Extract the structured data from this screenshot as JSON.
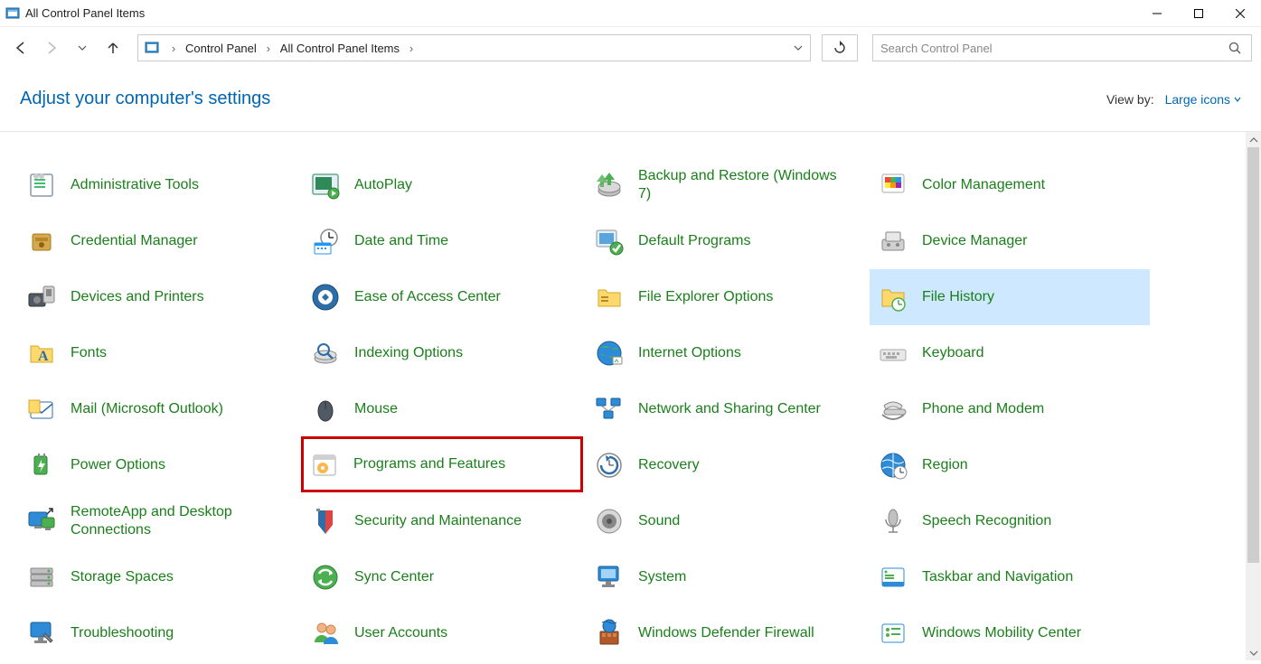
{
  "window": {
    "title": "All Control Panel Items"
  },
  "breadcrumb": {
    "root": "Control Panel",
    "current": "All Control Panel Items"
  },
  "search": {
    "placeholder": "Search Control Panel"
  },
  "heading": "Adjust your computer's settings",
  "viewby": {
    "label": "View by:",
    "value": "Large icons"
  },
  "items": [
    {
      "label": "Administrative Tools",
      "icon": "admin"
    },
    {
      "label": "AutoPlay",
      "icon": "autoplay"
    },
    {
      "label": "Backup and Restore (Windows 7)",
      "icon": "backup"
    },
    {
      "label": "Color Management",
      "icon": "color"
    },
    {
      "label": "Credential Manager",
      "icon": "credential"
    },
    {
      "label": "Date and Time",
      "icon": "datetime"
    },
    {
      "label": "Default Programs",
      "icon": "defaultprog"
    },
    {
      "label": "Device Manager",
      "icon": "devicemgr"
    },
    {
      "label": "Devices and Printers",
      "icon": "devices"
    },
    {
      "label": "Ease of Access Center",
      "icon": "ease"
    },
    {
      "label": "File Explorer Options",
      "icon": "fileexp"
    },
    {
      "label": "File History",
      "icon": "filehist",
      "selected": true
    },
    {
      "label": "Fonts",
      "icon": "fonts"
    },
    {
      "label": "Indexing Options",
      "icon": "indexing"
    },
    {
      "label": "Internet Options",
      "icon": "internet"
    },
    {
      "label": "Keyboard",
      "icon": "keyboard"
    },
    {
      "label": "Mail (Microsoft Outlook)",
      "icon": "mail"
    },
    {
      "label": "Mouse",
      "icon": "mouse"
    },
    {
      "label": "Network and Sharing Center",
      "icon": "network"
    },
    {
      "label": "Phone and Modem",
      "icon": "phone"
    },
    {
      "label": "Power Options",
      "icon": "power"
    },
    {
      "label": "Programs and Features",
      "icon": "programs",
      "highlighted": true
    },
    {
      "label": "Recovery",
      "icon": "recovery"
    },
    {
      "label": "Region",
      "icon": "region"
    },
    {
      "label": "RemoteApp and Desktop Connections",
      "icon": "remote"
    },
    {
      "label": "Security and Maintenance",
      "icon": "security"
    },
    {
      "label": "Sound",
      "icon": "sound"
    },
    {
      "label": "Speech Recognition",
      "icon": "speech"
    },
    {
      "label": "Storage Spaces",
      "icon": "storage"
    },
    {
      "label": "Sync Center",
      "icon": "sync"
    },
    {
      "label": "System",
      "icon": "system"
    },
    {
      "label": "Taskbar and Navigation",
      "icon": "taskbar"
    },
    {
      "label": "Troubleshooting",
      "icon": "trouble"
    },
    {
      "label": "User Accounts",
      "icon": "users"
    },
    {
      "label": "Windows Defender Firewall",
      "icon": "defender"
    },
    {
      "label": "Windows Mobility Center",
      "icon": "mobility"
    }
  ]
}
